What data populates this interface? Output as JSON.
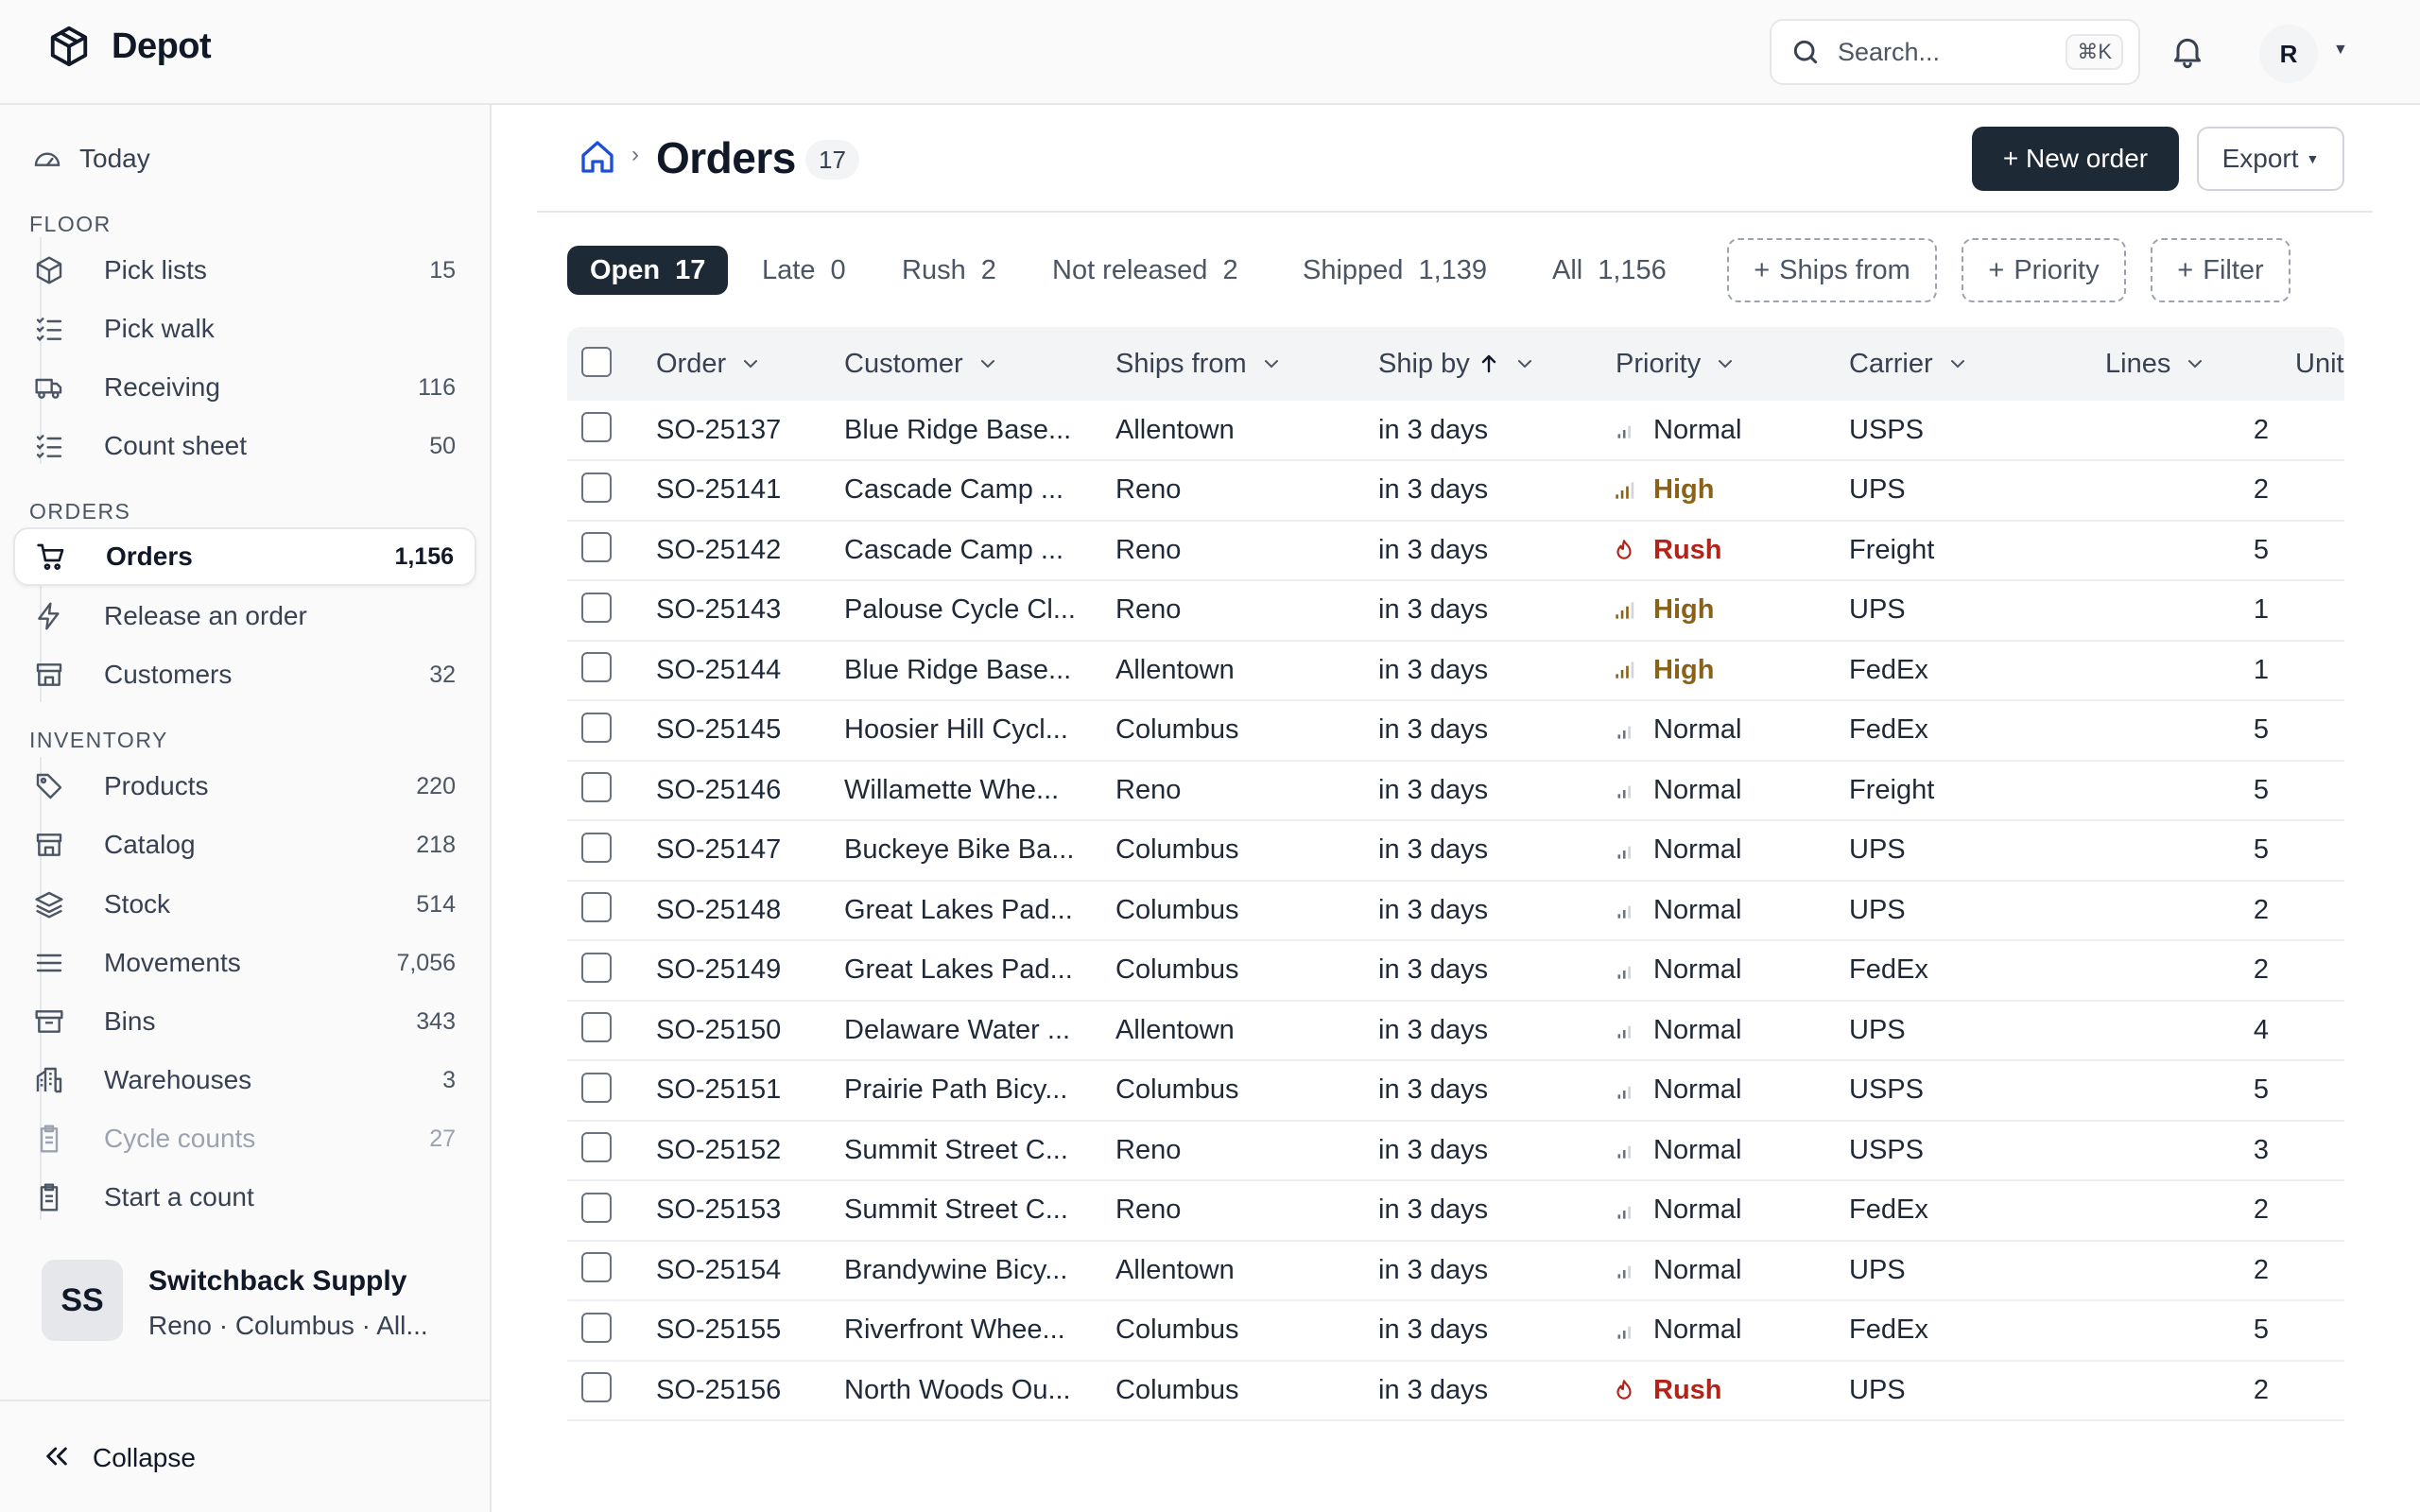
{
  "app": {
    "name": "Depot"
  },
  "topbar": {
    "search_placeholder": "Search...",
    "search_shortcut": "⌘K",
    "user_initial": "R"
  },
  "sidebar": {
    "today": {
      "label": "Today"
    },
    "floor_label": "FLOOR",
    "floor": [
      {
        "label": "Pick lists",
        "count": "15",
        "icon": "package-icon"
      },
      {
        "label": "Pick walk",
        "count": "",
        "icon": "checklist-icon"
      },
      {
        "label": "Receiving",
        "count": "116",
        "icon": "truck-icon"
      },
      {
        "label": "Count sheet",
        "count": "50",
        "icon": "checklist-icon"
      }
    ],
    "orders_label": "ORDERS",
    "orders": [
      {
        "label": "Orders",
        "count": "1,156",
        "icon": "cart-icon",
        "active": true
      },
      {
        "label": "Release an order",
        "count": "",
        "icon": "bolt-icon"
      },
      {
        "label": "Customers",
        "count": "32",
        "icon": "store-icon"
      }
    ],
    "inventory_label": "INVENTORY",
    "inventory": [
      {
        "label": "Products",
        "count": "220",
        "icon": "tag-icon"
      },
      {
        "label": "Catalog",
        "count": "218",
        "icon": "store-icon"
      },
      {
        "label": "Stock",
        "count": "514",
        "icon": "layers-icon"
      },
      {
        "label": "Movements",
        "count": "7,056",
        "icon": "list-icon"
      },
      {
        "label": "Bins",
        "count": "343",
        "icon": "archive-icon"
      },
      {
        "label": "Warehouses",
        "count": "3",
        "icon": "building-icon"
      },
      {
        "label": "Cycle counts",
        "count": "27",
        "icon": "clipboard-icon"
      },
      {
        "label": "Start a count",
        "count": "",
        "icon": "clipboard-icon"
      }
    ],
    "org": {
      "initials": "SS",
      "name": "Switchback Supply",
      "locations": "Reno · Columbus · All..."
    },
    "collapse_label": "Collapse"
  },
  "page": {
    "title": "Orders",
    "count": "17",
    "new_button": "+ New order",
    "export_button": "Export",
    "tabs": [
      {
        "label": "Open",
        "count": "17",
        "active": true
      },
      {
        "label": "Late",
        "count": "0"
      },
      {
        "label": "Rush",
        "count": "2"
      },
      {
        "label": "Not released",
        "count": "2"
      },
      {
        "label": "Shipped",
        "count": "1,139"
      },
      {
        "label": "All",
        "count": "1,156"
      }
    ],
    "filters": [
      "Ships from",
      "Priority",
      "Filter"
    ]
  },
  "table": {
    "columns": [
      "Order",
      "Customer",
      "Ships from",
      "Ship by",
      "Priority",
      "Carrier",
      "Lines",
      "Unit"
    ],
    "sorted_column": "Ship by",
    "rows": [
      {
        "order": "SO-25137",
        "customer": "Blue Ridge Base...",
        "ships_from": "Allentown",
        "ship_by": "in 3 days",
        "priority": "Normal",
        "carrier": "USPS",
        "lines": "2"
      },
      {
        "order": "SO-25141",
        "customer": "Cascade Camp ...",
        "ships_from": "Reno",
        "ship_by": "in 3 days",
        "priority": "High",
        "carrier": "UPS",
        "lines": "2"
      },
      {
        "order": "SO-25142",
        "customer": "Cascade Camp ...",
        "ships_from": "Reno",
        "ship_by": "in 3 days",
        "priority": "Rush",
        "carrier": "Freight",
        "lines": "5"
      },
      {
        "order": "SO-25143",
        "customer": "Palouse Cycle Cl...",
        "ships_from": "Reno",
        "ship_by": "in 3 days",
        "priority": "High",
        "carrier": "UPS",
        "lines": "1"
      },
      {
        "order": "SO-25144",
        "customer": "Blue Ridge Base...",
        "ships_from": "Allentown",
        "ship_by": "in 3 days",
        "priority": "High",
        "carrier": "FedEx",
        "lines": "1"
      },
      {
        "order": "SO-25145",
        "customer": "Hoosier Hill Cycl...",
        "ships_from": "Columbus",
        "ship_by": "in 3 days",
        "priority": "Normal",
        "carrier": "FedEx",
        "lines": "5"
      },
      {
        "order": "SO-25146",
        "customer": "Willamette Whe...",
        "ships_from": "Reno",
        "ship_by": "in 3 days",
        "priority": "Normal",
        "carrier": "Freight",
        "lines": "5"
      },
      {
        "order": "SO-25147",
        "customer": "Buckeye Bike Ba...",
        "ships_from": "Columbus",
        "ship_by": "in 3 days",
        "priority": "Normal",
        "carrier": "UPS",
        "lines": "5"
      },
      {
        "order": "SO-25148",
        "customer": "Great Lakes Pad...",
        "ships_from": "Columbus",
        "ship_by": "in 3 days",
        "priority": "Normal",
        "carrier": "UPS",
        "lines": "2"
      },
      {
        "order": "SO-25149",
        "customer": "Great Lakes Pad...",
        "ships_from": "Columbus",
        "ship_by": "in 3 days",
        "priority": "Normal",
        "carrier": "FedEx",
        "lines": "2"
      },
      {
        "order": "SO-25150",
        "customer": "Delaware Water ...",
        "ships_from": "Allentown",
        "ship_by": "in 3 days",
        "priority": "Normal",
        "carrier": "UPS",
        "lines": "4"
      },
      {
        "order": "SO-25151",
        "customer": "Prairie Path Bicy...",
        "ships_from": "Columbus",
        "ship_by": "in 3 days",
        "priority": "Normal",
        "carrier": "USPS",
        "lines": "5"
      },
      {
        "order": "SO-25152",
        "customer": "Summit Street C...",
        "ships_from": "Reno",
        "ship_by": "in 3 days",
        "priority": "Normal",
        "carrier": "USPS",
        "lines": "3"
      },
      {
        "order": "SO-25153",
        "customer": "Summit Street C...",
        "ships_from": "Reno",
        "ship_by": "in 3 days",
        "priority": "Normal",
        "carrier": "FedEx",
        "lines": "2"
      },
      {
        "order": "SO-25154",
        "customer": "Brandywine Bicy...",
        "ships_from": "Allentown",
        "ship_by": "in 3 days",
        "priority": "Normal",
        "carrier": "UPS",
        "lines": "2"
      },
      {
        "order": "SO-25155",
        "customer": "Riverfront Whee...",
        "ships_from": "Columbus",
        "ship_by": "in 3 days",
        "priority": "Normal",
        "carrier": "FedEx",
        "lines": "5"
      },
      {
        "order": "SO-25156",
        "customer": "North Woods Ou...",
        "ships_from": "Columbus",
        "ship_by": "in 3 days",
        "priority": "Rush",
        "carrier": "UPS",
        "lines": "2"
      }
    ]
  },
  "colors": {
    "primary": "#1e2936",
    "high": "#8a6116",
    "rush": "#b42318",
    "active_blue": "#1d4ed8"
  }
}
